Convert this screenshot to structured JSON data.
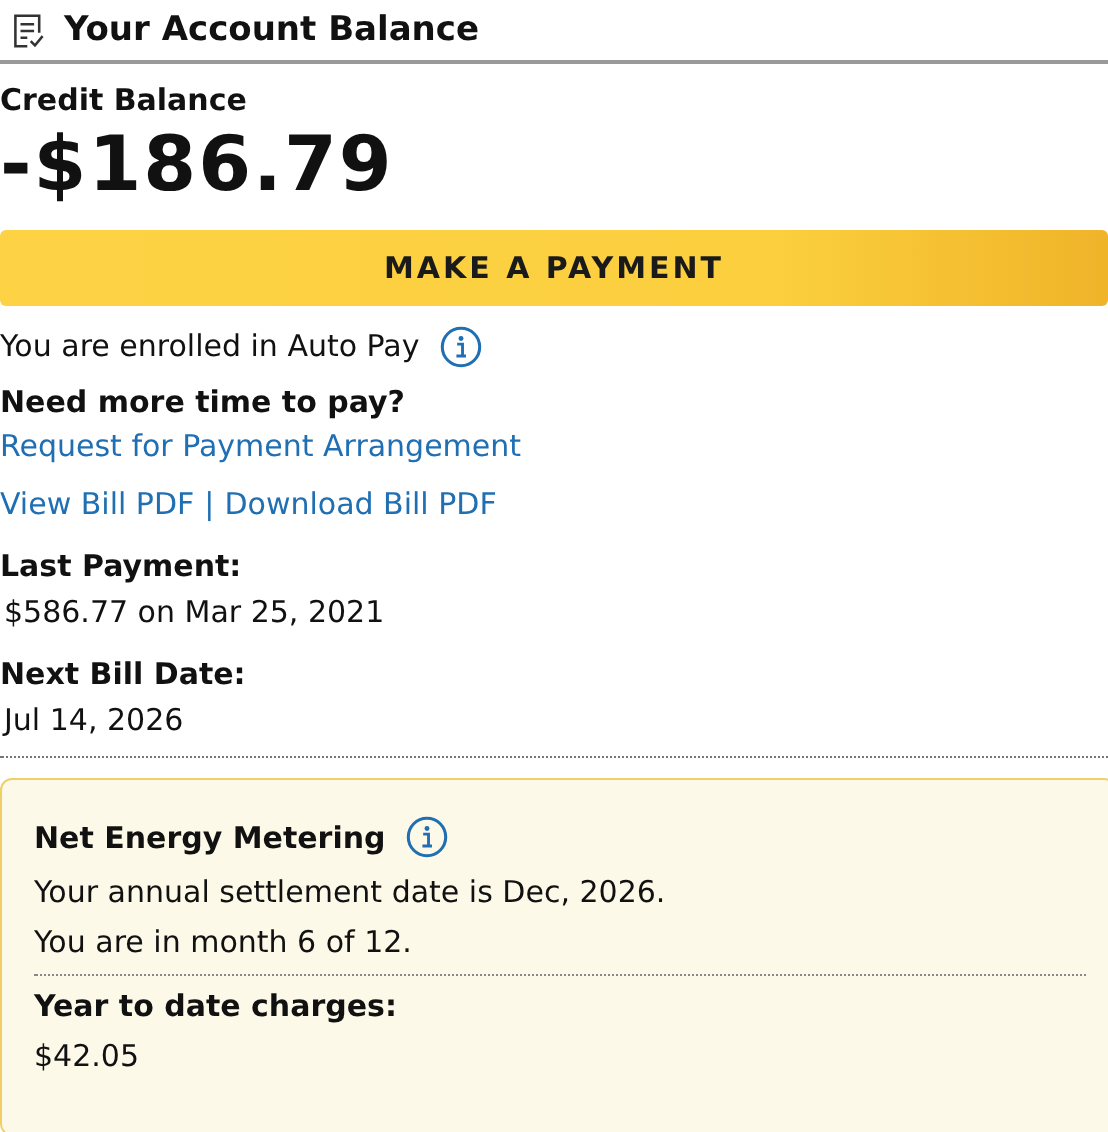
{
  "header": {
    "title": "Your Account Balance"
  },
  "balance": {
    "label": "Credit Balance",
    "amount": "-$186.79"
  },
  "payment_button": "MAKE A PAYMENT",
  "autopay": {
    "text": "You are enrolled in Auto Pay"
  },
  "arrangement": {
    "heading": "Need more time to pay?",
    "link": "Request for Payment Arrangement"
  },
  "bill_links": [
    {
      "label": "View Bill PDF"
    },
    {
      "label": "Download Bill PDF"
    }
  ],
  "bill_separator": "|",
  "details": [
    {
      "label": "Last Payment:",
      "value": "$586.77 on Mar 25, 2021"
    },
    {
      "label": "Next Bill Date:",
      "value": "Jul 14, 2026"
    }
  ],
  "nem": {
    "title": "Net Energy Metering",
    "lines": [
      "Your annual settlement date is Dec, 2026.",
      "You are in month 6 of 12."
    ],
    "charges_label": "Year to date charges:",
    "charges_value": "$42.05"
  }
}
